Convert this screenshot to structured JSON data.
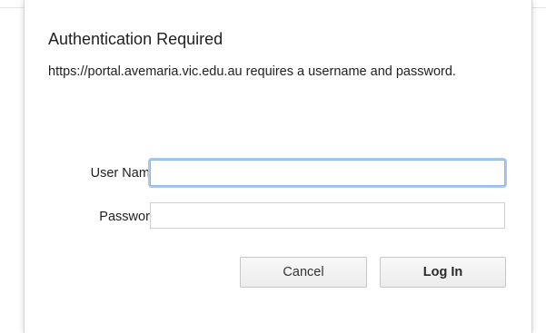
{
  "dialog": {
    "title": "Authentication Required",
    "message": "https://portal.avemaria.vic.edu.au requires a username and password.",
    "fields": {
      "username": {
        "label": "User Name:",
        "value": "",
        "placeholder": ""
      },
      "password": {
        "label": "Password:",
        "value": "",
        "placeholder": ""
      }
    },
    "buttons": {
      "cancel": "Cancel",
      "login": "Log In"
    }
  },
  "colors": {
    "focus_ring": "#a8c8ef",
    "button_border": "#c6c6c6",
    "text": "#1f1f1f"
  }
}
